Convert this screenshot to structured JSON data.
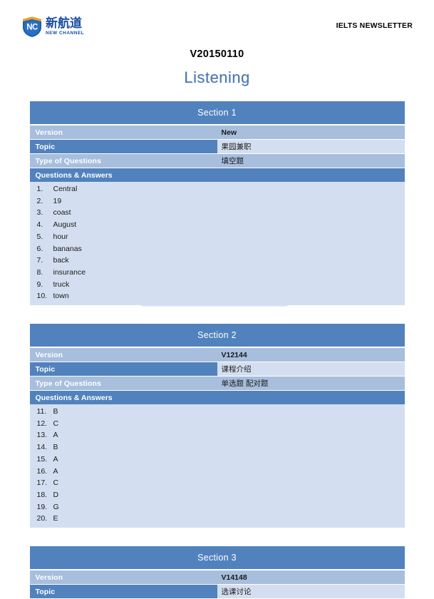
{
  "header": {
    "logo": {
      "shield_text": "NC",
      "chinese_name": "新航道",
      "english_name": "NEW CHANNEL",
      "shield_color": "#1b5fad",
      "accent_color": "#f0a020"
    },
    "newsletter_label": "IELTS NEWSLETTER"
  },
  "title": {
    "code": "V20150110",
    "skill": "Listening",
    "skill_color": "#4a76ad"
  },
  "labels": {
    "version": "Version",
    "topic": "Topic",
    "type_of_questions": "Type of Questions",
    "questions_and_answers": "Questions & Answers"
  },
  "sections": [
    {
      "heading": "Section 1",
      "version": "New",
      "topic": "果园兼职",
      "type_of_questions": "填空题",
      "has_qa": true,
      "answers": [
        {
          "num": "1.",
          "text": "Central"
        },
        {
          "num": "2.",
          "text": "19"
        },
        {
          "num": "3.",
          "text": "coast"
        },
        {
          "num": "4.",
          "text": "August"
        },
        {
          "num": "5.",
          "text": "hour"
        },
        {
          "num": "6.",
          "text": "bananas"
        },
        {
          "num": "7.",
          "text": "back"
        },
        {
          "num": "8.",
          "text": "insurance"
        },
        {
          "num": "9.",
          "text": "truck"
        },
        {
          "num": "10.",
          "text": "town"
        }
      ]
    },
    {
      "heading": "Section 2",
      "version": "V12144",
      "topic": "课程介绍",
      "type_of_questions": "单选题 配对题",
      "has_qa": true,
      "answers": [
        {
          "num": "11.",
          "text": "B"
        },
        {
          "num": "12.",
          "text": "C"
        },
        {
          "num": "13.",
          "text": "A"
        },
        {
          "num": "14.",
          "text": "B"
        },
        {
          "num": "15.",
          "text": "A"
        },
        {
          "num": "16.",
          "text": "A"
        },
        {
          "num": "17.",
          "text": "C"
        },
        {
          "num": "18.",
          "text": "D"
        },
        {
          "num": "19.",
          "text": "G"
        },
        {
          "num": "20.",
          "text": "E"
        }
      ]
    },
    {
      "heading": "Section 3",
      "version": "V14148",
      "topic": "选课讨论",
      "type_of_questions": null,
      "has_qa": false,
      "answers": []
    }
  ],
  "theme": {
    "header_blue": "#5182bd",
    "row_mid_blue": "#a7bedd",
    "row_light_blue": "#d3dff0",
    "text_dark": "#1a1a1a"
  }
}
